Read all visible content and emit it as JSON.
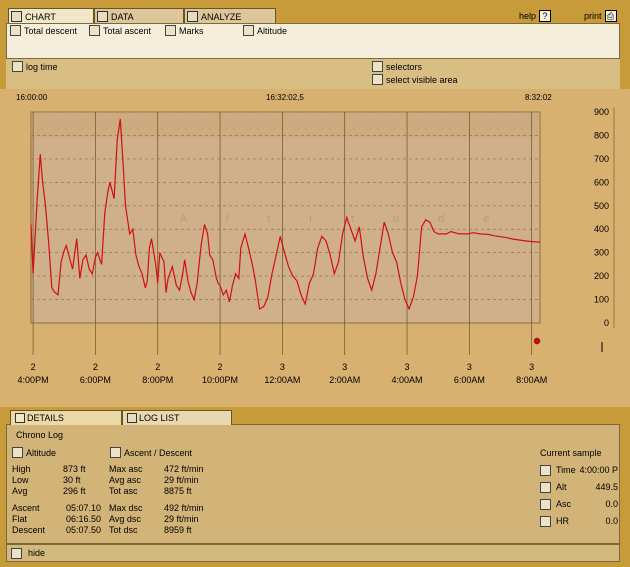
{
  "tabs": [
    {
      "label": "CHART",
      "icon": "chart-icon"
    },
    {
      "label": "DATA",
      "icon": "data-icon"
    },
    {
      "label": "ANALYZE",
      "icon": "analyze-icon"
    }
  ],
  "top_right": {
    "help": "help",
    "print": "print"
  },
  "options": {
    "total_descent": "Total descent",
    "total_ascent": "Total ascent",
    "marks": "Marks",
    "altitude": "Altitude",
    "log_time": "log time",
    "selectors": "selectors",
    "select_visible_area": "select visible area"
  },
  "time_header": {
    "start": "16:00:00",
    "mid": "16:32:02,5",
    "end": "8:32:02"
  },
  "watermark": "A l t i t u d e",
  "chart_data": {
    "type": "line",
    "xlabel": "",
    "ylabel": "",
    "ylim": [
      0,
      900
    ],
    "grid": true,
    "y_ticks": [
      "900",
      "800",
      "700",
      "600",
      "500",
      "400",
      "300",
      "200",
      "100",
      "0"
    ],
    "x_ticks": [
      {
        "day": "2",
        "time": "4:00PM"
      },
      {
        "day": "2",
        "time": "6:00PM"
      },
      {
        "day": "2",
        "time": "8:00PM"
      },
      {
        "day": "2",
        "time": "10:00PM"
      },
      {
        "day": "3",
        "time": "12:00AM"
      },
      {
        "day": "3",
        "time": "2:00AM"
      },
      {
        "day": "3",
        "time": "4:00AM"
      },
      {
        "day": "3",
        "time": "6:00AM"
      },
      {
        "day": "3",
        "time": "8:00AM"
      }
    ],
    "series": [
      {
        "color": "#d01010",
        "x_hours": [
          0,
          0.1,
          0.3,
          0.45,
          0.55,
          0.7,
          0.85,
          1.0,
          1.15,
          1.3,
          1.45,
          1.6,
          1.7,
          1.85,
          2.0,
          2.2,
          2.35,
          2.5,
          2.65,
          2.8,
          2.95,
          3.1,
          3.2,
          3.4,
          3.55,
          3.7,
          3.8,
          4.0,
          4.15,
          4.3,
          4.45,
          4.55,
          4.65,
          4.75,
          4.9,
          5.05,
          5.2,
          5.35,
          5.5,
          5.6,
          5.7,
          5.8,
          6.0,
          6.1,
          6.2,
          6.4,
          6.5,
          6.6,
          6.8,
          7.0,
          7.15,
          7.3,
          7.4,
          7.55,
          7.7,
          7.85,
          8.0,
          8.1,
          8.2,
          8.35,
          8.5,
          8.6,
          8.75,
          8.9,
          9.0,
          9.1,
          9.25,
          9.4,
          9.55,
          9.7,
          9.85,
          10.0,
          10.1,
          10.3,
          10.5,
          10.65,
          10.8,
          11.0,
          11.2,
          11.4,
          11.6,
          11.8,
          12.0,
          12.2,
          12.4,
          12.6,
          12.8,
          13.0,
          13.2,
          13.4,
          13.6,
          13.8,
          14.0,
          14.2,
          14.4,
          14.6,
          14.8,
          15.0,
          15.2,
          15.4,
          15.6,
          15.8,
          16.0,
          16.2,
          16.4,
          16.6,
          16.8,
          17.0,
          17.2,
          17.4,
          17.6,
          17.8,
          18.0,
          18.2,
          18.4,
          18.6,
          18.8,
          19.0,
          19.2,
          19.4,
          19.6,
          19.8,
          20.0,
          20.2,
          20.4,
          20.6,
          20.8,
          21.0,
          21.3,
          21.6,
          22.0,
          22.3,
          22.6,
          22.9,
          23.2,
          23.5,
          23.8,
          24.0,
          24.3,
          24.5
        ],
        "values": [
          420,
          210,
          530,
          720,
          610,
          500,
          340,
          150,
          130,
          120,
          260,
          310,
          330,
          280,
          230,
          360,
          190,
          270,
          290,
          230,
          210,
          280,
          300,
          250,
          470,
          560,
          600,
          530,
          780,
          870,
          650,
          500,
          440,
          380,
          400,
          290,
          240,
          210,
          150,
          180,
          320,
          360,
          250,
          170,
          300,
          260,
          130,
          190,
          240,
          160,
          140,
          210,
          270,
          180,
          130,
          100,
          170,
          260,
          340,
          420,
          380,
          290,
          270,
          200,
          170,
          160,
          120,
          140,
          90,
          160,
          210,
          190,
          320,
          380,
          310,
          250,
          180,
          60,
          70,
          110,
          210,
          290,
          370,
          300,
          240,
          200,
          180,
          120,
          80,
          170,
          210,
          320,
          370,
          350,
          290,
          210,
          260,
          380,
          450,
          400,
          350,
          410,
          280,
          190,
          140,
          210,
          320,
          430,
          380,
          300,
          260,
          170,
          100,
          60,
          110,
          200,
          410,
          440,
          430,
          390,
          380,
          380,
          380,
          390,
          385,
          380,
          380,
          380,
          385,
          380,
          378,
          372,
          368,
          364,
          358,
          354,
          350,
          348,
          346,
          345
        ],
        "end_marker_value": -200
      }
    ]
  },
  "details": {
    "tab_details": "DETAILS",
    "tab_loglist": "LOG LIST",
    "chrono_log": "Chrono Log",
    "altitude_heading": "Altitude",
    "asc_desc_heading": "Ascent / Descent",
    "stats": [
      {
        "label": "High",
        "value": "873 ft",
        "label2": "Max asc",
        "value2": "472 ft/min"
      },
      {
        "label": "Low",
        "value": "30 ft",
        "label2": "Avg asc",
        "value2": "29 ft/min"
      },
      {
        "label": "Avg",
        "value": "296 ft",
        "label2": "Tot asc",
        "value2": "8875 ft"
      }
    ],
    "stats2": [
      {
        "label": "Ascent",
        "value": "05:07.10",
        "label2": "Max dsc",
        "value2": "492 ft/min"
      },
      {
        "label": "Flat",
        "value": "06:16.50",
        "label2": "Avg dsc",
        "value2": "29 ft/min"
      },
      {
        "label": "Descent",
        "value": "05:07.50",
        "label2": "Tot dsc",
        "value2": "8959 ft"
      }
    ],
    "current_sample": {
      "title": "Current sample",
      "rows": [
        {
          "label": "Time",
          "value": "4:00:00 P"
        },
        {
          "label": "Alt",
          "value": "449.5"
        },
        {
          "label": "Asc",
          "value": "0.0"
        },
        {
          "label": "HR",
          "value": "0.0"
        }
      ]
    },
    "hide": "hide"
  }
}
